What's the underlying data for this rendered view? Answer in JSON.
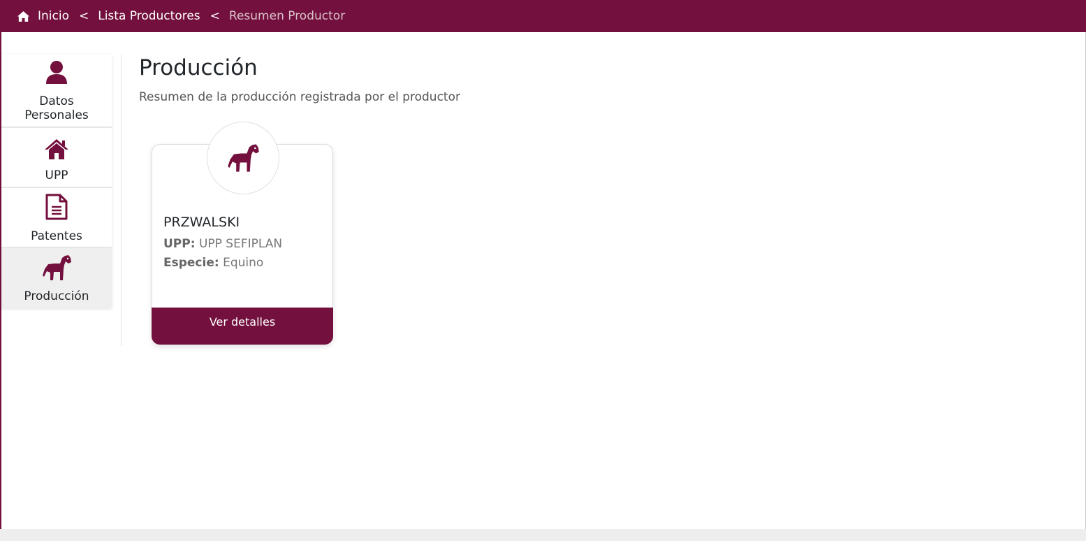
{
  "breadcrumb": {
    "home_icon": "home-icon",
    "items": [
      "Inicio",
      "Lista Productores",
      "Resumen Productor"
    ],
    "separator": "<"
  },
  "sidebar": {
    "items": [
      {
        "label_line1": "Datos",
        "label_line2": "Personales",
        "icon": "user-icon"
      },
      {
        "label": "UPP",
        "icon": "house-icon"
      },
      {
        "label": "Patentes",
        "icon": "document-icon"
      },
      {
        "label": "Producción",
        "icon": "horse-icon",
        "active": true
      }
    ]
  },
  "main": {
    "title": "Producción",
    "subtitle": "Resumen de la producción registrada por el productor"
  },
  "card": {
    "icon": "horse-icon",
    "name": "PRZWALSKI",
    "upp_label": "UPP:",
    "upp_value": "UPP SEFIPLAN",
    "especie_label": "Especie:",
    "especie_value": "Equino",
    "button_label": "Ver detalles"
  },
  "colors": {
    "brand": "#73103d",
    "active_bg": "#efefef"
  }
}
